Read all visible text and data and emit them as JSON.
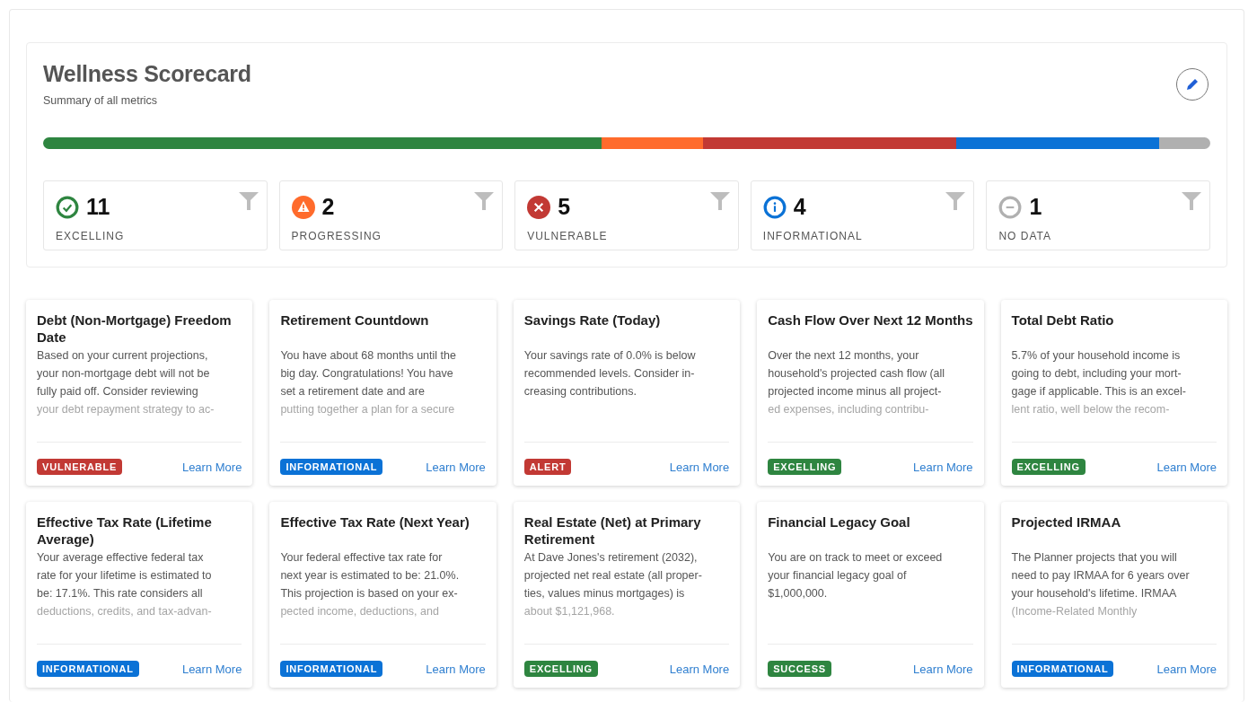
{
  "scorecard": {
    "title": "Wellness Scorecard",
    "subtitle": "Summary of all metrics",
    "segments": [
      {
        "color": "#2e8540"
      },
      {
        "color": "#ff6b2c"
      },
      {
        "color": "#c23934"
      },
      {
        "color": "#0b72d6"
      },
      {
        "color": "#b0b0b0"
      }
    ]
  },
  "stats": [
    {
      "kind": "excelling",
      "count": "11",
      "label": "EXCELLING",
      "color": "#2e8540"
    },
    {
      "kind": "progressing",
      "count": "2",
      "label": "PROGRESSING",
      "color": "#ff6b2c"
    },
    {
      "kind": "vulnerable",
      "count": "5",
      "label": "VULNERABLE",
      "color": "#c23934"
    },
    {
      "kind": "informational",
      "count": "4",
      "label": "INFORMATIONAL",
      "color": "#0b72d6"
    },
    {
      "kind": "no_data",
      "count": "1",
      "label": "NO DATA",
      "color": "#b0b0b0"
    }
  ],
  "metrics": [
    {
      "title": "Debt (Non-Mortgage) Freedom Date",
      "description_lines": [
        "Based on your current projections,",
        "your non-mortgage debt will not be",
        "fully paid off. Consider reviewing",
        "your debt repayment strategy to ac-"
      ],
      "badge": {
        "label": "VULNERABLE",
        "color": "#c23934"
      },
      "link": "Learn More"
    },
    {
      "title": "Retirement Countdown",
      "description_lines": [
        "You have about 68 months until the",
        "big day. Congratulations! You have",
        "set a retirement date and are",
        "putting together a plan for a secure"
      ],
      "badge": {
        "label": "INFORMATIONAL",
        "color": "#0b72d6"
      },
      "link": "Learn More"
    },
    {
      "title": "Savings Rate (Today)",
      "description_lines": [
        "Your savings rate of 0.0% is below",
        "recommended levels. Consider in-",
        "creasing contributions."
      ],
      "badge": {
        "label": "ALERT",
        "color": "#c23934"
      },
      "link": "Learn More"
    },
    {
      "title": "Cash Flow Over Next 12 Months",
      "description_lines": [
        "Over the next 12 months, your",
        "household's projected cash flow (all",
        "projected income minus all project-",
        "ed expenses, including contribu-"
      ],
      "badge": {
        "label": "EXCELLING",
        "color": "#2e8540"
      },
      "link": "Learn More"
    },
    {
      "title": "Total Debt Ratio",
      "description_lines": [
        "5.7% of your household income is",
        "going to debt, including your mort-",
        "gage if applicable. This is an excel-",
        "lent ratio, well below the recom-"
      ],
      "badge": {
        "label": "EXCELLING",
        "color": "#2e8540"
      },
      "link": "Learn More"
    },
    {
      "title": "Effective Tax Rate (Lifetime Average)",
      "description_lines": [
        "Your average effective federal tax",
        "rate for your lifetime is estimated to",
        "be: 17.1%. This rate considers all",
        "deductions, credits, and tax-advan-"
      ],
      "badge": {
        "label": "INFORMATIONAL",
        "color": "#0b72d6"
      },
      "link": "Learn More"
    },
    {
      "title": "Effective Tax Rate (Next Year)",
      "description_lines": [
        "Your federal effective tax rate for",
        "next year is estimated to be: 21.0%.",
        "This projection is based on your ex-",
        "pected income, deductions, and"
      ],
      "badge": {
        "label": "INFORMATIONAL",
        "color": "#0b72d6"
      },
      "link": "Learn More"
    },
    {
      "title": "Real Estate (Net) at Primary Retirement",
      "description_lines": [
        "At Dave Jones's retirement (2032),",
        "projected net real estate (all proper-",
        "ties, values minus mortgages) is",
        "about $1,121,968."
      ],
      "badge": {
        "label": "EXCELLING",
        "color": "#2e8540"
      },
      "link": "Learn More"
    },
    {
      "title": "Financial Legacy Goal",
      "description_lines": [
        "You are on track to meet or exceed",
        "your financial legacy goal of",
        "$1,000,000."
      ],
      "badge": {
        "label": "SUCCESS",
        "color": "#2e8540"
      },
      "link": "Learn More"
    },
    {
      "title": "Projected IRMAA",
      "description_lines": [
        "The Planner projects that you will",
        "need to pay IRMAA for 6 years over",
        "your household's lifetime. IRMAA",
        "(Income-Related Monthly"
      ],
      "badge": {
        "label": "INFORMATIONAL",
        "color": "#0b72d6"
      },
      "link": "Learn More"
    }
  ]
}
